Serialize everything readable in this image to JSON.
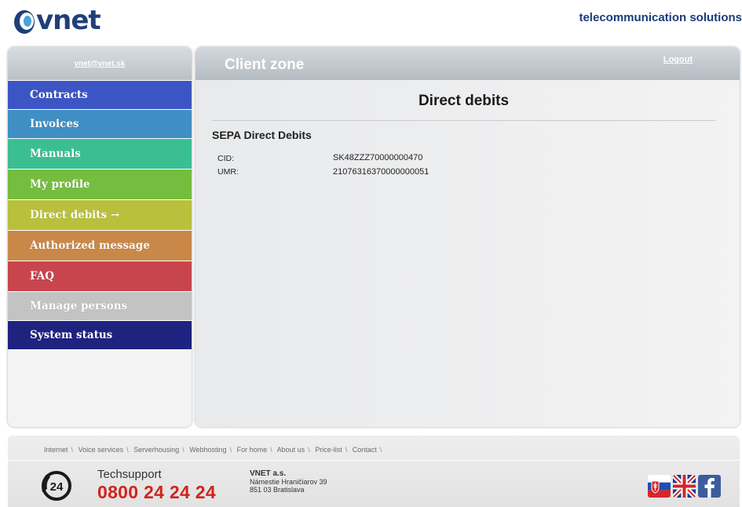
{
  "header": {
    "logo_text": "vnet",
    "tagline": "telecommunication solutions"
  },
  "sidebar": {
    "user_email": "vnet@vnet.sk",
    "items": [
      {
        "label": "Contracts",
        "color": "#3c55c4"
      },
      {
        "label": "Invoices",
        "color": "#3f8fc4"
      },
      {
        "label": "Manuals",
        "color": "#3bbf92"
      },
      {
        "label": "My profile",
        "color": "#74bd3e"
      },
      {
        "label": "Direct debits →",
        "color": "#b9c03c"
      },
      {
        "label": "Authorized message",
        "color": "#c98848"
      },
      {
        "label": "FAQ",
        "color": "#c8454e"
      },
      {
        "label": "Manage persons",
        "color": "#c3c3c3"
      },
      {
        "label": "System status",
        "color": "#1e2380"
      }
    ]
  },
  "main": {
    "zone_title": "Client zone",
    "logout_label": "Logout",
    "page_title": "Direct debits",
    "section_title": "SEPA Direct Debits",
    "fields": [
      {
        "label": "CID:",
        "value": "SK48ZZZ70000000470"
      },
      {
        "label": "UMR:",
        "value": "21076316370000000051"
      }
    ]
  },
  "footer": {
    "links": [
      "Internet",
      "Voice services",
      "Serverhousing",
      "Webhosting",
      "For home",
      "About us",
      "Price-list",
      "Contact"
    ],
    "support_label": "Techsupport",
    "support_number": "0800 24 24 24",
    "phone_icon_text": "24",
    "company_name": "VNET a.s.",
    "company_street": "Námestie Hraničiarov 39",
    "company_city": "851 03 Bratislava",
    "flags": [
      "slovak-flag-icon",
      "uk-flag-icon",
      "facebook-icon"
    ]
  }
}
